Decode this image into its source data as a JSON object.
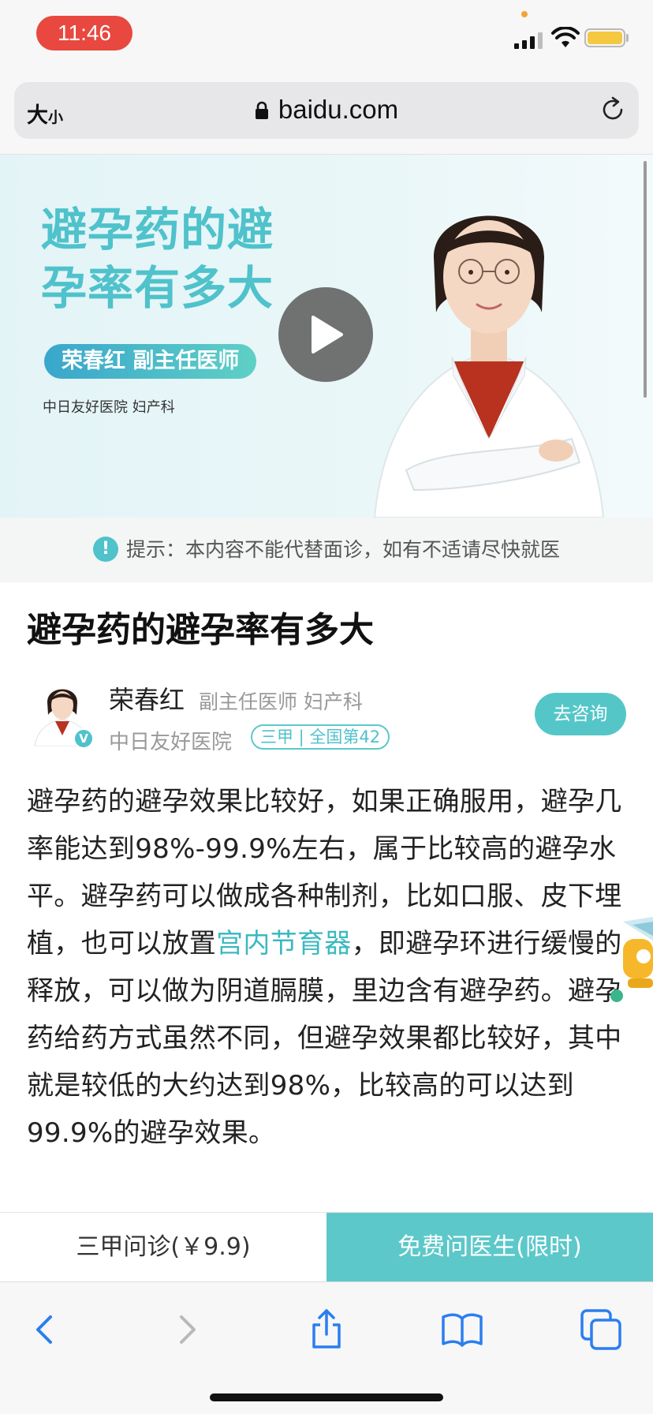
{
  "status_bar": {
    "time": "11:46"
  },
  "address_bar": {
    "text_size_label": "大",
    "text_size_small": "小",
    "url": "baidu.com"
  },
  "banner": {
    "title": "避孕药的避孕率有多大",
    "doctor": "荣春红  副主任医师",
    "hospital": "中日友好医院 妇产科"
  },
  "notice": {
    "icon": "!",
    "text": "提示：本内容不能代替面诊，如有不适请尽快就医"
  },
  "article": {
    "title": "避孕药的避孕率有多大",
    "author": {
      "name": "荣春红",
      "title": "副主任医师  妇产科",
      "hospital": "中日友好医院",
      "badge": "三甲 | 全国第42",
      "verified": "V"
    },
    "consult_button": "去咨询",
    "body_before_link": "避孕药的避孕效果比较好，如果正确服用，避孕几率能达到98%-99.9%左右，属于比较高的避孕水平。避孕药可以做成各种制剂，比如口服、皮下埋植，也可以放置",
    "body_link": "宫内节育器",
    "body_after_link": "，即避孕环进行缓慢的释放，可以做为阴道膈膜，里边含有避孕药。避孕药给药方式虽然不同，但避孕效果都比较好，其中就是较低的大约达到98%，比较高的可以达到99.9%的避孕效果。"
  },
  "action_bar": {
    "left_label": "三甲问诊(￥9.9)",
    "right_label": "免费问医生(限时)"
  },
  "colors": {
    "accent": "#4fc2cb",
    "button": "#5cc8c9",
    "time_pill": "#e8483f",
    "link": "#3bb9c0"
  },
  "toolbar": {
    "icons": [
      "back-icon",
      "forward-icon",
      "share-icon",
      "bookmarks-icon",
      "tabs-icon"
    ]
  }
}
